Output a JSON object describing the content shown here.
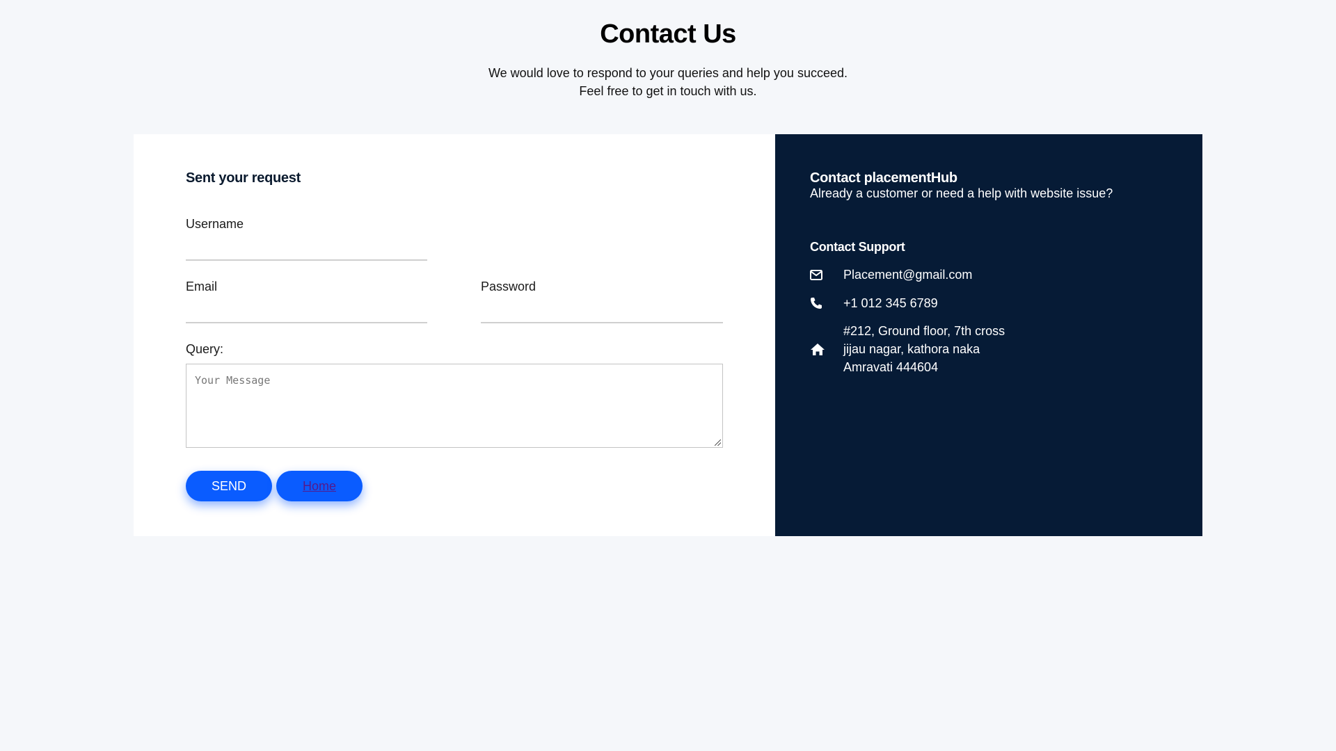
{
  "header": {
    "title": "Contact Us",
    "subtitle_line1": "We would love to respond to your queries and help you succeed.",
    "subtitle_line2": "Feel free to get in touch with us."
  },
  "form": {
    "heading": "Sent your request",
    "username_label": "Username",
    "email_label": "Email",
    "password_label": "Password",
    "query_label": "Query:",
    "query_placeholder": "Your Message",
    "send_label": "SEND",
    "home_label": "Home"
  },
  "contact": {
    "heading": "Contact placementHub",
    "subheading": "Already a customer or need a help with website issue?",
    "support_heading": "Contact Support",
    "email": "Placement@gmail.com",
    "phone": "+1 012 345 6789",
    "address": [
      "#212, Ground floor, 7th cross",
      "jijau nagar, kathora naka",
      "Amravati 444604"
    ]
  },
  "colors": {
    "panel": "#061b36",
    "button": "#0a5cff",
    "background": "#f5f7fa"
  }
}
